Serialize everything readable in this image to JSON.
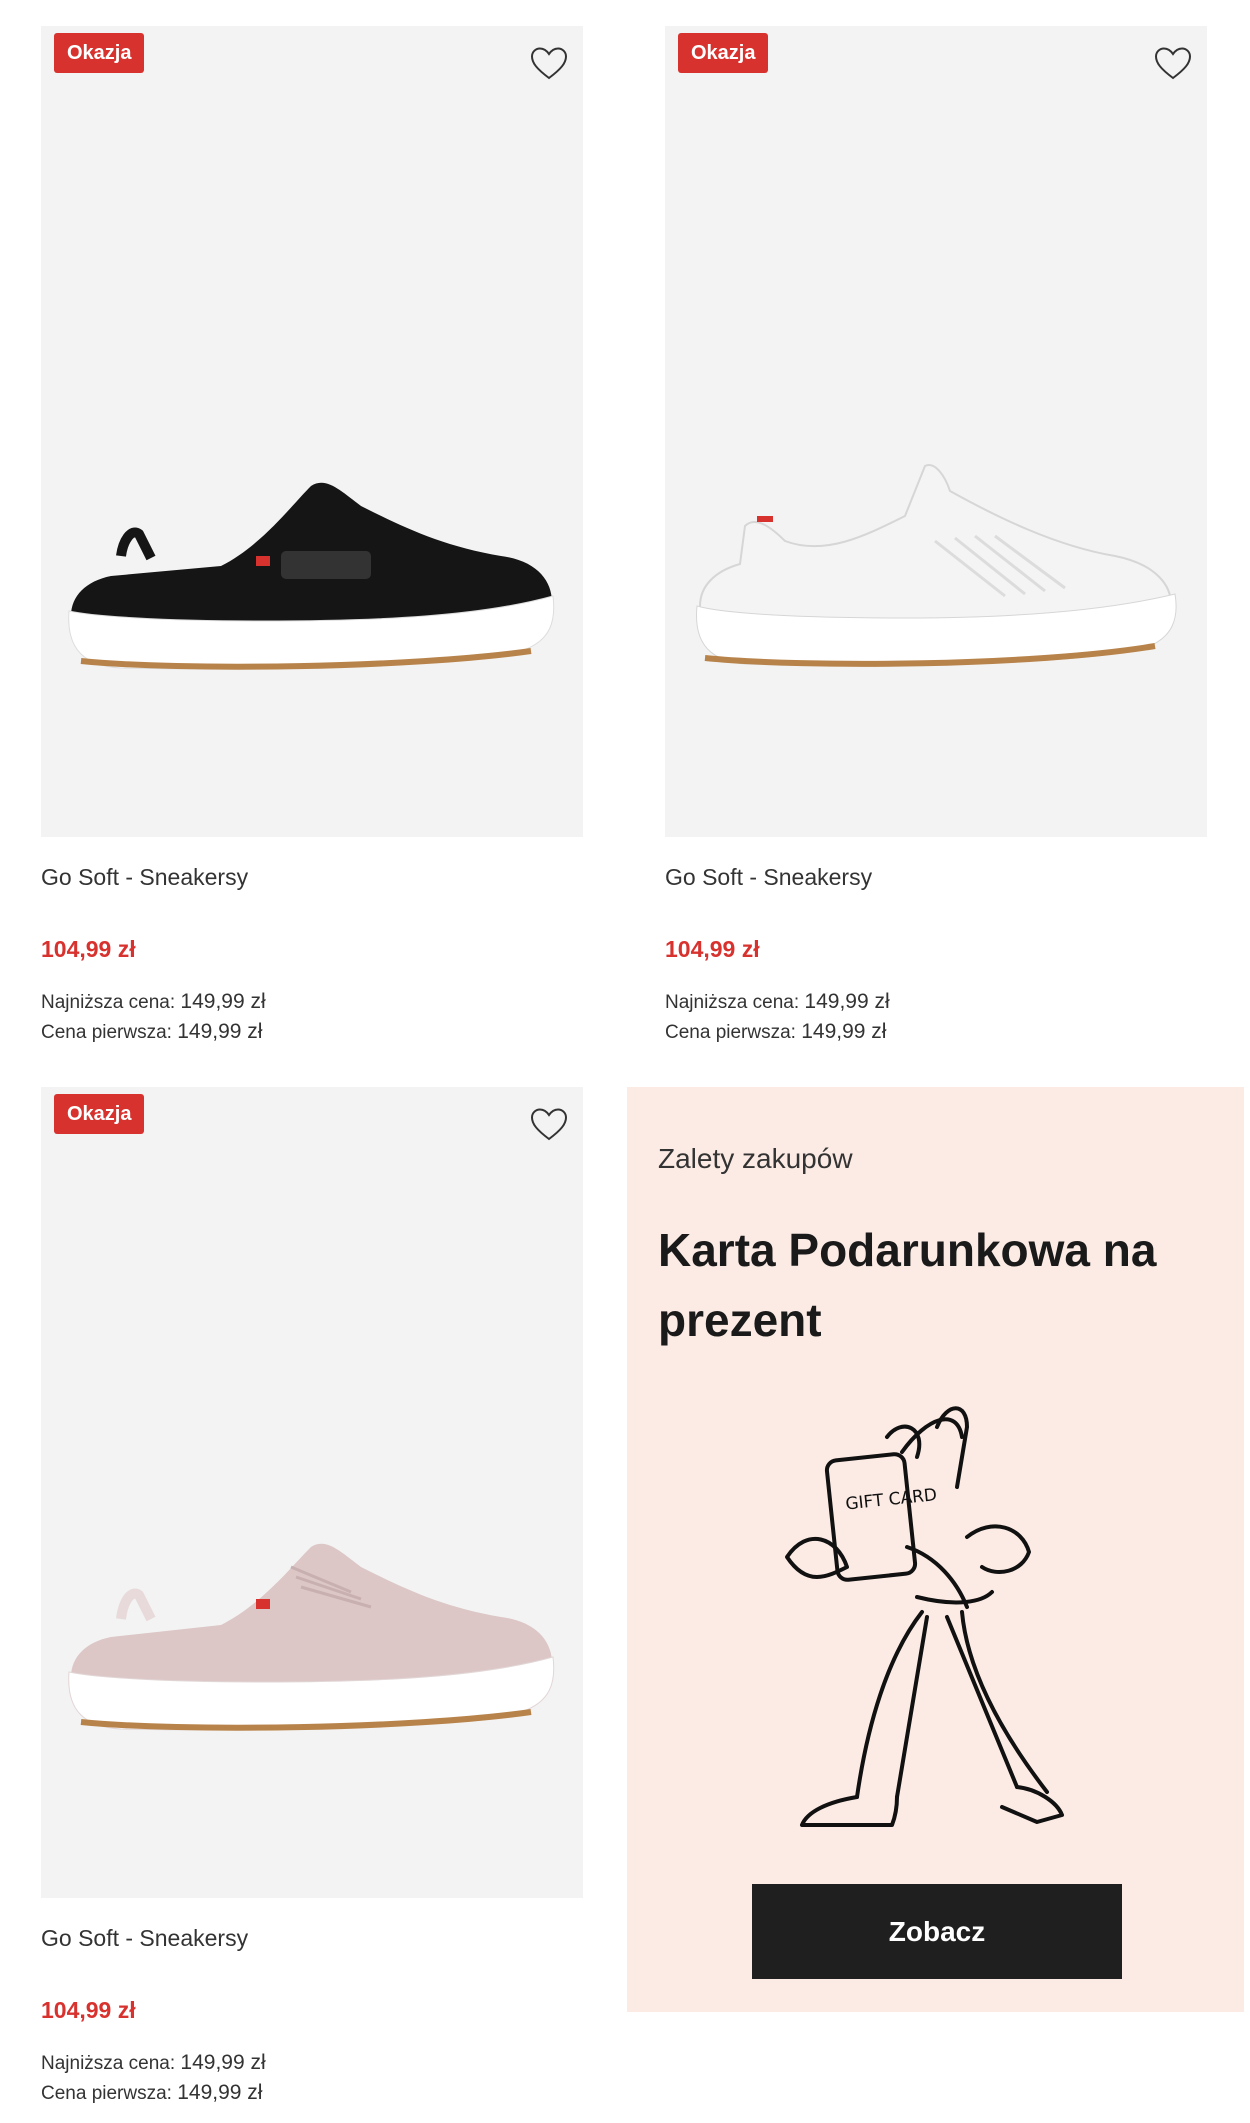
{
  "products": [
    {
      "badge": "Okazja",
      "title": "Go Soft - Sneakersy",
      "price": "104,99 zł",
      "lowest_label": "Najniższa cena:",
      "lowest_value": "149,99 zł",
      "first_label": "Cena pierwsza:",
      "first_value": "149,99 zł",
      "shoe_icon": "black-sneaker-image",
      "upper_color": "#151515"
    },
    {
      "badge": "Okazja",
      "title": "Go Soft - Sneakersy",
      "price": "104,99 zł",
      "lowest_label": "Najniższa cena:",
      "lowest_value": "149,99 zł",
      "first_label": "Cena pierwsza:",
      "first_value": "149,99 zł",
      "shoe_icon": "white-sneaker-image",
      "upper_color": "#f2f2f2"
    },
    {
      "badge": "Okazja",
      "title": "Go Soft - Sneakersy",
      "price": "104,99 zł",
      "lowest_label": "Najniższa cena:",
      "lowest_value": "149,99 zł",
      "first_label": "Cena pierwsza:",
      "first_value": "149,99 zł",
      "shoe_icon": "pink-sneaker-image",
      "upper_color": "#dcc6c6"
    }
  ],
  "promo": {
    "kicker": "Zalety zakupów",
    "headline": "Karta Podarunkowa na prezent",
    "illustration_text": "GIFT CARD",
    "cta": "Zobacz"
  },
  "colors": {
    "sale_red": "#d8322f",
    "promo_bg": "#fcebe4",
    "cta_bg": "#1f1f1f",
    "photo_bg": "#f3f3f3"
  }
}
